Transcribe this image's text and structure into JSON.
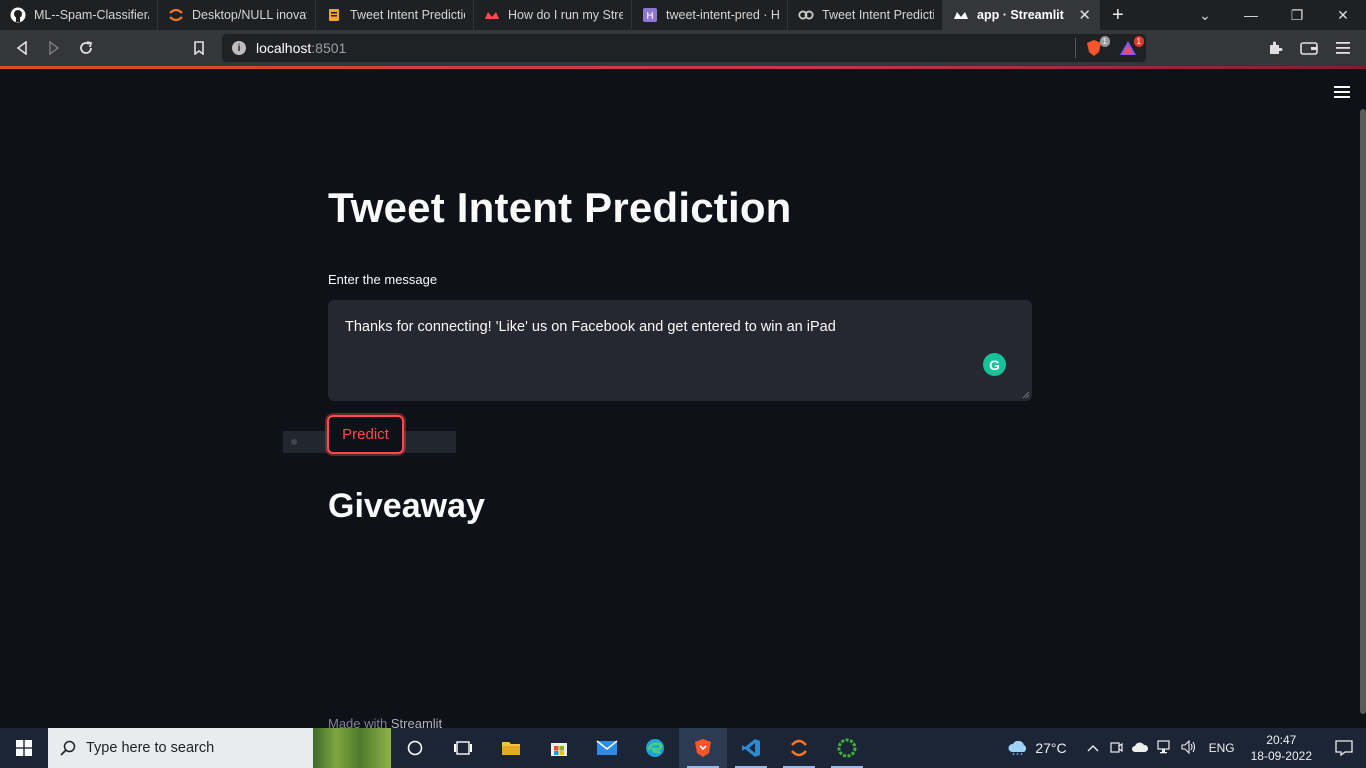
{
  "browser": {
    "tabs": [
      {
        "label": "ML--Spam-Classifier/re",
        "icon": "github-icon"
      },
      {
        "label": "Desktop/NULL inovatio",
        "icon": "jupyter-icon"
      },
      {
        "label": "Tweet Intent Predictio",
        "icon": "notebook-icon"
      },
      {
        "label": "How do I run my Strea",
        "icon": "streamlit-icon"
      },
      {
        "label": "tweet-intent-pred · He",
        "icon": "heroku-icon"
      },
      {
        "label": "Tweet Intent Predictio",
        "icon": "colab-icon"
      },
      {
        "label": "app · Streamlit",
        "icon": "streamlit-icon",
        "active": true
      }
    ],
    "new_tab": "+",
    "url_host": "localhost",
    "url_port": ":8501",
    "brave_badge": "1",
    "rewards_badge": "1"
  },
  "app": {
    "title": "Tweet Intent Prediction",
    "input_label": "Enter the message",
    "input_value": "Thanks for connecting! 'Like' us on Facebook and get entered to win an iPad",
    "grammarly": "G",
    "predict_label": "Predict",
    "result": "Giveaway",
    "footer_prefix": "Made with",
    "footer_brand": "Streamlit"
  },
  "taskbar": {
    "search_placeholder": "Type here to search",
    "weather": "27°C",
    "language": "ENG",
    "time": "20:47",
    "date": "18-09-2022"
  },
  "colors": {
    "accent": "#ff4b4b",
    "background": "#0e1117",
    "textarea": "#262730"
  }
}
